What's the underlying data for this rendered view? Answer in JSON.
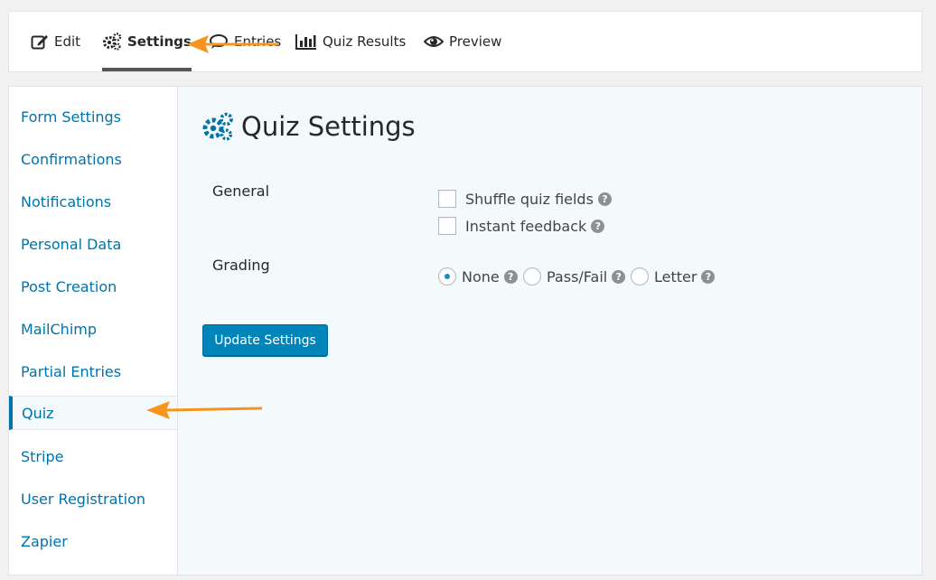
{
  "toolbar": {
    "tabs": [
      {
        "label": "Edit",
        "icon": "edit-icon"
      },
      {
        "label": "Settings",
        "icon": "gears-icon",
        "active": true
      },
      {
        "label": "Entries",
        "icon": "comment-icon"
      },
      {
        "label": "Quiz Results",
        "icon": "bar-chart-icon"
      },
      {
        "label": "Preview",
        "icon": "eye-icon"
      }
    ]
  },
  "sidebar": {
    "items": [
      {
        "label": "Form Settings"
      },
      {
        "label": "Confirmations"
      },
      {
        "label": "Notifications"
      },
      {
        "label": "Personal Data"
      },
      {
        "label": "Post Creation"
      },
      {
        "label": "MailChimp"
      },
      {
        "label": "Partial Entries"
      },
      {
        "label": "Quiz",
        "active": true
      },
      {
        "label": "Stripe"
      },
      {
        "label": "User Registration"
      },
      {
        "label": "Zapier"
      }
    ]
  },
  "main": {
    "title": "Quiz Settings",
    "general": {
      "label": "General",
      "options": [
        {
          "label": "Shuffle quiz fields",
          "checked": false
        },
        {
          "label": "Instant feedback",
          "checked": false
        }
      ]
    },
    "grading": {
      "label": "Grading",
      "options": [
        {
          "label": "None",
          "selected": true
        },
        {
          "label": "Pass/Fail",
          "selected": false
        },
        {
          "label": "Letter",
          "selected": false
        }
      ]
    },
    "update_button": "Update Settings",
    "help_glyph": "?"
  },
  "colors": {
    "accent": "#0073aa",
    "button": "#0085ba",
    "annotation_arrow": "#f7941d",
    "panel_bg": "#f4f9fc"
  }
}
